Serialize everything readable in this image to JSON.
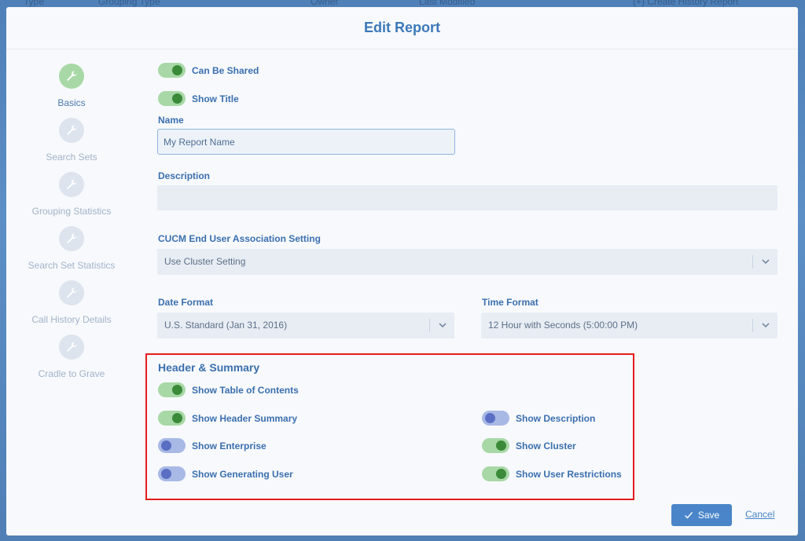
{
  "background_header": {
    "col1": "Type",
    "col2": "Grouping Type",
    "col3": "Owner",
    "col4": "Last Modified",
    "action": "(+) Create History Report"
  },
  "modal": {
    "title": "Edit Report"
  },
  "sidebar": {
    "items": [
      {
        "label": "Basics",
        "icon": "wrench-icon",
        "active": true
      },
      {
        "label": "Search Sets",
        "icon": "wrench-icon",
        "active": false
      },
      {
        "label": "Grouping Statistics",
        "icon": "wrench-icon",
        "active": false
      },
      {
        "label": "Search Set Statistics",
        "icon": "wrench-icon",
        "active": false
      },
      {
        "label": "Call History Details",
        "icon": "wrench-icon",
        "active": false
      },
      {
        "label": "Cradle to Grave",
        "icon": "wrench-icon",
        "active": false
      }
    ]
  },
  "form": {
    "can_be_shared": {
      "label": "Can Be Shared",
      "on": true
    },
    "show_title": {
      "label": "Show Title",
      "on": true
    },
    "name": {
      "label": "Name",
      "value": "My Report Name"
    },
    "description": {
      "label": "Description",
      "value": ""
    },
    "cucm": {
      "label": "CUCM End User Association Setting",
      "value": "Use Cluster Setting"
    },
    "date_format": {
      "label": "Date Format",
      "value": "U.S. Standard (Jan 31, 2016)"
    },
    "time_format": {
      "label": "Time Format",
      "value": "12 Hour with Seconds (5:00:00 PM)"
    }
  },
  "header_summary": {
    "title": "Header & Summary",
    "show_toc": {
      "label": "Show Table of Contents",
      "on": true
    },
    "show_header_summary": {
      "label": "Show Header Summary",
      "on": true
    },
    "show_enterprise": {
      "label": "Show Enterprise",
      "on": false
    },
    "show_generating_user": {
      "label": "Show Generating User",
      "on": false
    },
    "show_description": {
      "label": "Show Description",
      "on": false
    },
    "show_cluster": {
      "label": "Show Cluster",
      "on": true
    },
    "show_user_restrictions": {
      "label": "Show User Restrictions",
      "on": true
    }
  },
  "footer": {
    "save_label": "Save",
    "cancel_label": "Cancel"
  },
  "colors": {
    "accent": "#3b78b8",
    "toggle_on": "#a8d8a6",
    "toggle_off": "#a9b9e6",
    "highlight_border": "#e51c1c"
  }
}
